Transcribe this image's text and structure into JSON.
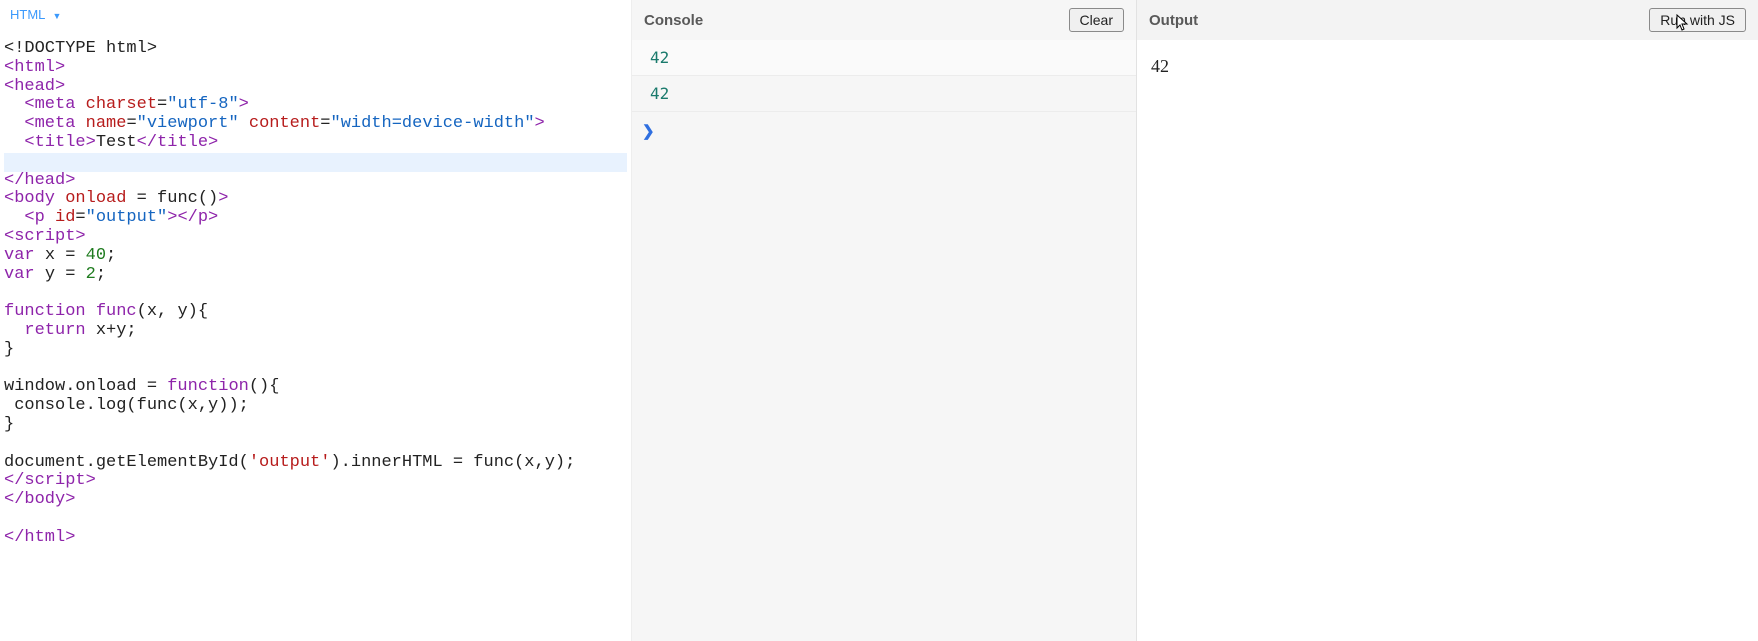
{
  "editor": {
    "language_label": "HTML",
    "code_lines": [
      {
        "html": "<span class='plain'>&lt;!DOCTYPE html&gt;</span>"
      },
      {
        "html": "<span class='tag'>&lt;html&gt;</span>"
      },
      {
        "html": "<span class='tag'>&lt;head&gt;</span>"
      },
      {
        "html": "  <span class='tag'>&lt;meta</span> <span class='attrn'>charset</span>=<span class='attrv'>\"utf-8\"</span><span class='tag'>&gt;</span>"
      },
      {
        "html": "  <span class='tag'>&lt;meta</span> <span class='attrn'>name</span>=<span class='attrv'>\"viewport\"</span> <span class='attrn'>content</span>=<span class='attrv'>\"width=device-width\"</span><span class='tag'>&gt;</span>"
      },
      {
        "html": "  <span class='tag'>&lt;title&gt;</span><span class='plain'>Test</span><span class='tag'>&lt;/title&gt;</span>"
      },
      {
        "html": " ",
        "active": true
      },
      {
        "html": "<span class='tag'>&lt;/head&gt;</span>"
      },
      {
        "html": "<span class='tag'>&lt;body</span> <span class='attrn'>onload</span> <span class='plain'>= func()</span><span class='tag'>&gt;</span>"
      },
      {
        "html": "  <span class='tag'>&lt;p</span> <span class='attrn'>id</span>=<span class='attrv'>\"output\"</span><span class='tag'>&gt;&lt;/p&gt;</span>"
      },
      {
        "html": "<span class='tag'>&lt;script&gt;</span>"
      },
      {
        "html": "<span class='kw'>var</span> <span class='plain'>x = </span><span class='num'>40</span><span class='plain'>;</span>"
      },
      {
        "html": "<span class='kw'>var</span> <span class='plain'>y = </span><span class='num'>2</span><span class='plain'>;</span>"
      },
      {
        "html": " "
      },
      {
        "html": "<span class='kw'>function</span> <span class='fn'>func</span><span class='plain'>(x, y){</span>"
      },
      {
        "html": "  <span class='kw'>return</span> <span class='plain'>x+y;</span>"
      },
      {
        "html": "<span class='plain'>}</span>"
      },
      {
        "html": " "
      },
      {
        "html": "<span class='plain'>window.onload = </span><span class='kw'>function</span><span class='plain'>(){</span>"
      },
      {
        "html": " <span class='plain'>console.log(func(x,y));</span>"
      },
      {
        "html": "<span class='plain'>}</span>"
      },
      {
        "html": " "
      },
      {
        "html": "<span class='plain'>document.getElementById(</span><span class='str'>'output'</span><span class='plain'>).innerHTML = func(x,y);</span>"
      },
      {
        "html": "<span class='tag'>&lt;/script&gt;</span>"
      },
      {
        "html": "<span class='tag'>&lt;/body&gt;</span>"
      },
      {
        "html": " "
      },
      {
        "html": "<span class='tag'>&lt;/html&gt;</span>"
      }
    ]
  },
  "console": {
    "title": "Console",
    "clear_label": "Clear",
    "lines": [
      "42",
      "42"
    ],
    "prompt_glyph": "❯"
  },
  "output": {
    "title": "Output",
    "run_label": "Run with JS",
    "body_text": "42"
  }
}
